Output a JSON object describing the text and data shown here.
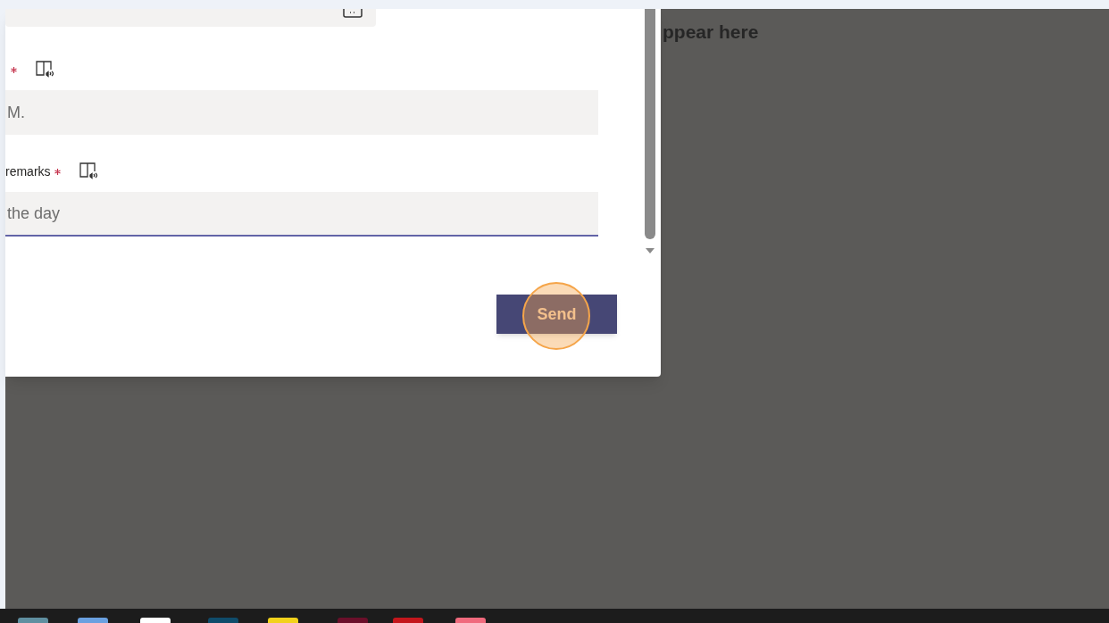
{
  "background": {
    "text": "ppear here"
  },
  "form": {
    "fields": [
      {
        "required": true,
        "value": "M.",
        "focused": false
      },
      {
        "label": "remarks",
        "required": true,
        "value": "the day",
        "focused": true
      }
    ],
    "send_button": "Send"
  },
  "taskbar": {
    "apps": [
      {
        "color": "#5f8fa0"
      },
      {
        "color": "#6aa0e0"
      },
      {
        "color": "#ffffff"
      },
      {
        "color": "#0f4c6b"
      },
      {
        "color": "#f2d21b"
      },
      {
        "color": "#6b0f2a"
      },
      {
        "color": "#c4161c"
      },
      {
        "color": "#f06a7d"
      }
    ]
  }
}
